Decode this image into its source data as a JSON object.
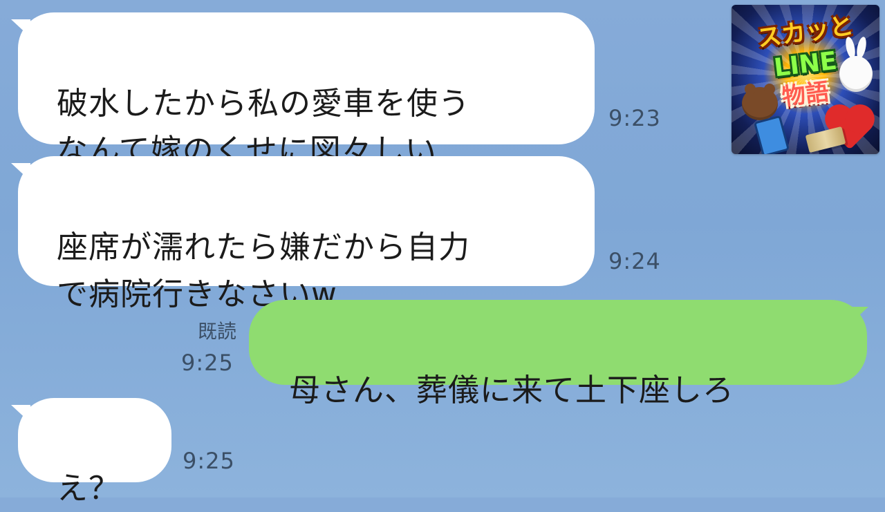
{
  "messages": [
    {
      "side": "incoming",
      "text": "破水したから私の愛車を使う\nなんて嫁のくせに図々しい",
      "time": "9:23"
    },
    {
      "side": "incoming",
      "text": "座席が濡れたら嫌だから自力\nで病院行きなさいw",
      "time": "9:24"
    },
    {
      "side": "outgoing",
      "read_label": "既読",
      "text": "母さん、葬儀に来て土下座しろ",
      "time": "9:25"
    },
    {
      "side": "incoming",
      "text": "え？",
      "time": "9:25"
    }
  ],
  "logo": {
    "line1": "スカッと",
    "line2": "LINE",
    "line3": "物語",
    "icons": [
      "bear-icon",
      "bunny-icon",
      "phone-icon",
      "broken-heart-icon",
      "money-icon"
    ]
  },
  "colors": {
    "background": "#86abd8",
    "incoming_bubble": "#ffffff",
    "outgoing_bubble": "#8fdc70",
    "meta_text": "#3b4f66"
  }
}
